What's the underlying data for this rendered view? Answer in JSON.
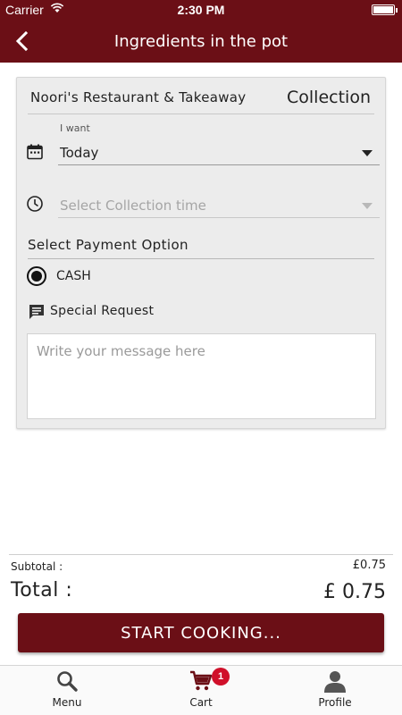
{
  "status_bar": {
    "carrier": "Carrier",
    "time": "2:30 PM"
  },
  "header": {
    "title": "Ingredients in the pot",
    "back_icon": "chevron-left-icon"
  },
  "colors": {
    "brand": "#6b0f16",
    "badge": "#d0102a",
    "card_background": "#ececec"
  },
  "order": {
    "restaurant_name": "Noori's Restaurant & Takeaway",
    "type": "Collection",
    "date_label": "I want",
    "date_value": "Today",
    "time_placeholder": "Select Collection time",
    "payment_title": "Select Payment Option",
    "payment_option": "CASH",
    "payment_selected": true,
    "special_request_label": "Special Request",
    "message_placeholder": "Write your message here"
  },
  "summary": {
    "subtotal_label": "Subtotal :",
    "subtotal_value": "£0.75",
    "total_label": "Total :",
    "total_value": "£ 0.75"
  },
  "cta_label": "START COOKING...",
  "tabs": [
    {
      "label": "Menu",
      "icon": "search-icon"
    },
    {
      "label": "Cart",
      "icon": "cart-icon",
      "badge": "1"
    },
    {
      "label": "Profile",
      "icon": "person-icon"
    }
  ]
}
